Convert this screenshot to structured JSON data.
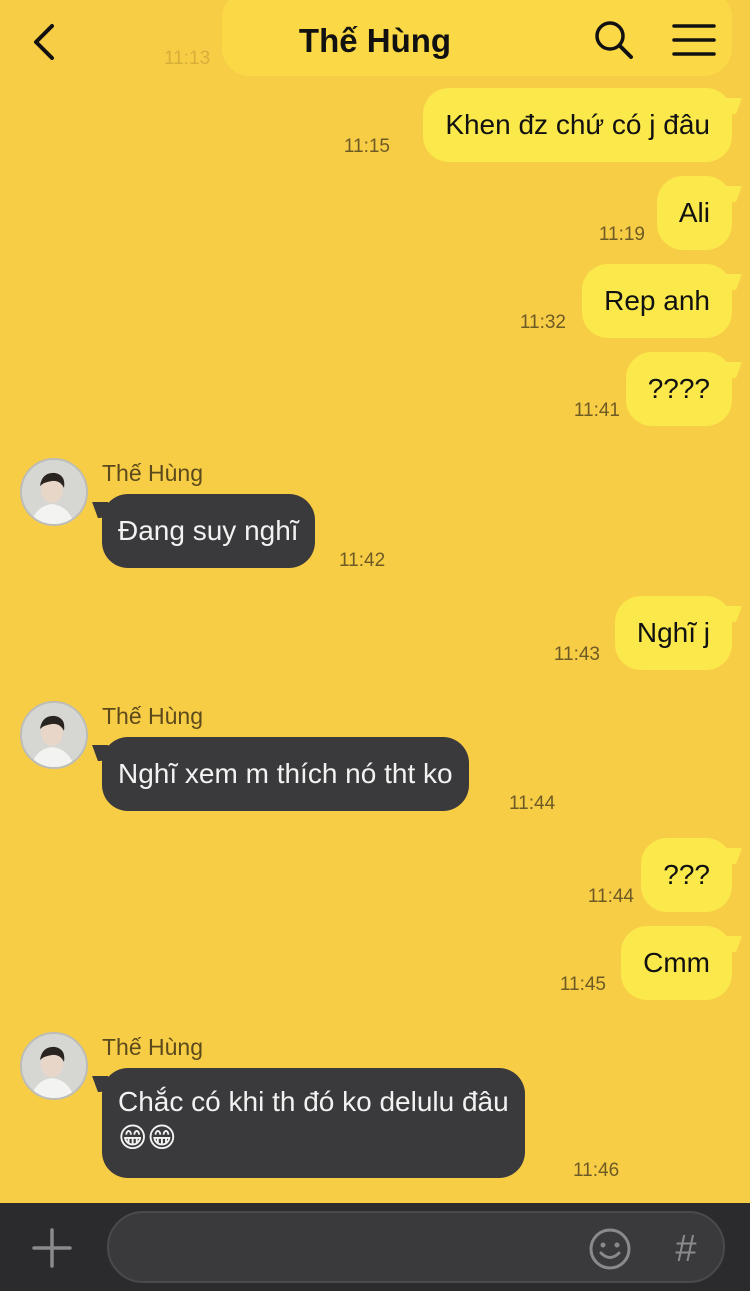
{
  "header": {
    "title": "Thế Hùng",
    "ghost_time": "11:13"
  },
  "colors": {
    "background": "#f8cd46",
    "outgoing_bubble": "#fbe84b",
    "incoming_bubble": "#3a3a3c",
    "composer": "#2b2b2d"
  },
  "messages": [
    {
      "dir": "out",
      "text": "Khen đz chứ có j đâu",
      "time": "11:15"
    },
    {
      "dir": "out",
      "text": "Ali",
      "time": "11:19"
    },
    {
      "dir": "out",
      "text": "Rep anh",
      "time": "11:32"
    },
    {
      "dir": "out",
      "text": "????",
      "time": "11:41"
    },
    {
      "dir": "in",
      "sender": "Thế Hùng",
      "text": "Đang suy nghĩ",
      "time": "11:42"
    },
    {
      "dir": "out",
      "text": "Nghĩ j",
      "time": "11:43"
    },
    {
      "dir": "in",
      "sender": "Thế Hùng",
      "text": "Nghĩ xem m thích nó tht ko",
      "time": "11:44"
    },
    {
      "dir": "out",
      "text": "???",
      "time": "11:44"
    },
    {
      "dir": "out",
      "text": "Cmm",
      "time": "11:45"
    },
    {
      "dir": "in",
      "sender": "Thế Hùng",
      "text_line1": "Chắc có khi th đó ko delulu đâu",
      "text_line2": "😁😁",
      "time": "11:46"
    }
  ],
  "composer": {
    "plus_icon": "plus-icon",
    "emoji_icon": "emoji-icon",
    "hash_label": "#"
  }
}
